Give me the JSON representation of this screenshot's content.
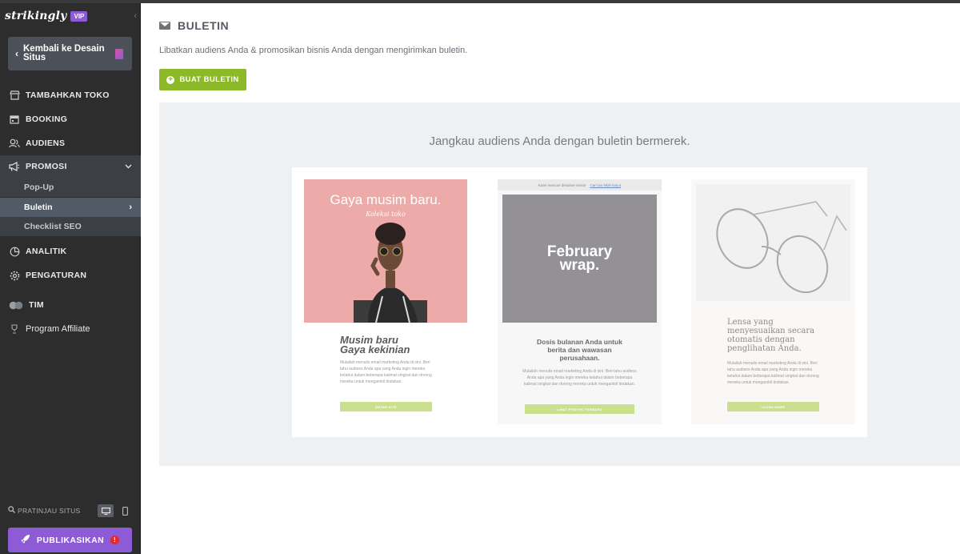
{
  "sidebar": {
    "logo": "strikingly",
    "vip_badge": "VIP",
    "back_button": "Kembali ke Desain Situs",
    "nav": [
      {
        "label": "TAMBAHKAN TOKO",
        "icon": "store-icon"
      },
      {
        "label": "BOOKING",
        "icon": "calendar-icon"
      },
      {
        "label": "AUDIENS",
        "icon": "audience-icon"
      },
      {
        "label": "PROMOSI",
        "icon": "megaphone-icon"
      },
      {
        "label": "ANALITIK",
        "icon": "pie-chart-icon"
      },
      {
        "label": "PENGATURAN",
        "icon": "gear-icon"
      },
      {
        "label": "TIM",
        "icon": "team-icon"
      },
      {
        "label": "Program Affiliate",
        "icon": "trophy-icon"
      }
    ],
    "promosi_sub": [
      {
        "label": "Pop-Up"
      },
      {
        "label": "Buletin"
      },
      {
        "label": "Checklist SEO"
      }
    ],
    "preview_label": "PRATINJAU SITUS",
    "publish_button": "PUBLIKASIKAN",
    "publish_alert": "!"
  },
  "main": {
    "title": "BULETIN",
    "description": "Libatkan audiens Anda & promosikan bisnis Anda dengan mengirimkan buletin.",
    "create_button": "BUAT BULETIN",
    "panel_heading": "Jangkau audiens Anda dengan buletin bermerek.",
    "templates": [
      {
        "image_heading": "Gaya musim baru.",
        "image_subheading": "Koleksi toko",
        "title_line1": "Musim baru",
        "title_line2": "Gaya kekinian",
        "body": "Mulailah menulis email marketing Anda di sini. Beri tahu audiens Anda apa yang Anda ingin mereka ketahui dalam beberapa kalimat singkat dan dorong mereka untuk mengambil tindakan.",
        "button": "ENTER SITE"
      },
      {
        "top_strip": "Kami mencari desainer senior",
        "top_strip_link": "Cari tau lebih lanjut",
        "image_heading_line1": "February",
        "image_heading_line2": "wrap.",
        "title": "Dosis bulanan Anda untuk berita dan wawasan perusahaan.",
        "body": "Mulailah menulis email marketing Anda di sini. Beri tahu audiens Anda apa yang Anda ingin mereka ketahui dalam beberapa kalimat singkat dan dorong mereka untuk mengambil tindakan.",
        "button": "LIHAT PROYEK TERBARU"
      },
      {
        "title": "Lensa yang menyesuaikan secara otomatis dengan penglihatan Anda.",
        "body": "Mulailah menulis email marketing Anda di sini. Beri tahu audiens Anda apa yang Anda ingin mereka ketahui dalam beberapa kalimat singkat dan dorong mereka untuk mengambil tindakan.",
        "button": "LEARN MORE"
      }
    ]
  },
  "colors": {
    "sidebar_bg": "#2d2d2d",
    "accent_purple": "#8e5bd6",
    "accent_green": "#8cb928",
    "panel_bg": "#eff0f2"
  }
}
